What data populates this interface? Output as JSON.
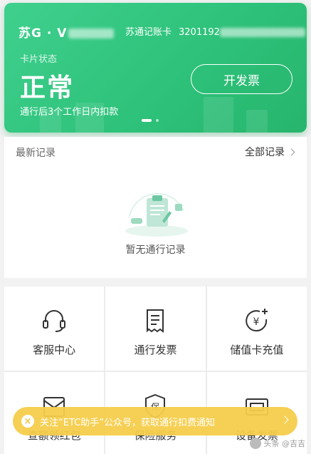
{
  "card": {
    "plate": "苏G · V",
    "account_label": "苏通记账卡",
    "account_number": "3201192",
    "status_label": "卡片状态",
    "status": "正常",
    "note": "通行后3个工作日内扣款",
    "invoice_button": "开发票",
    "color": "#2ec27a"
  },
  "records": {
    "title": "最新记录",
    "all_link": "全部记录",
    "empty_text": "暂无通行记录"
  },
  "services": [
    {
      "label": "客服中心",
      "icon": "headset-icon"
    },
    {
      "label": "通行发票",
      "icon": "receipt-icon"
    },
    {
      "label": "储值卡充值",
      "icon": "yuan-plus-icon"
    },
    {
      "label": "查额领红包",
      "icon": "red-envelope-icon"
    },
    {
      "label": "保险服务",
      "icon": "insurance-shield-icon"
    },
    {
      "label": "设备发票",
      "icon": "device-invoice-icon"
    }
  ],
  "toast": {
    "text": "关注“ETC助手”公众号，获取通行扣费通知",
    "color": "#f5cd4b"
  },
  "watermark": "头条 @吉吉"
}
